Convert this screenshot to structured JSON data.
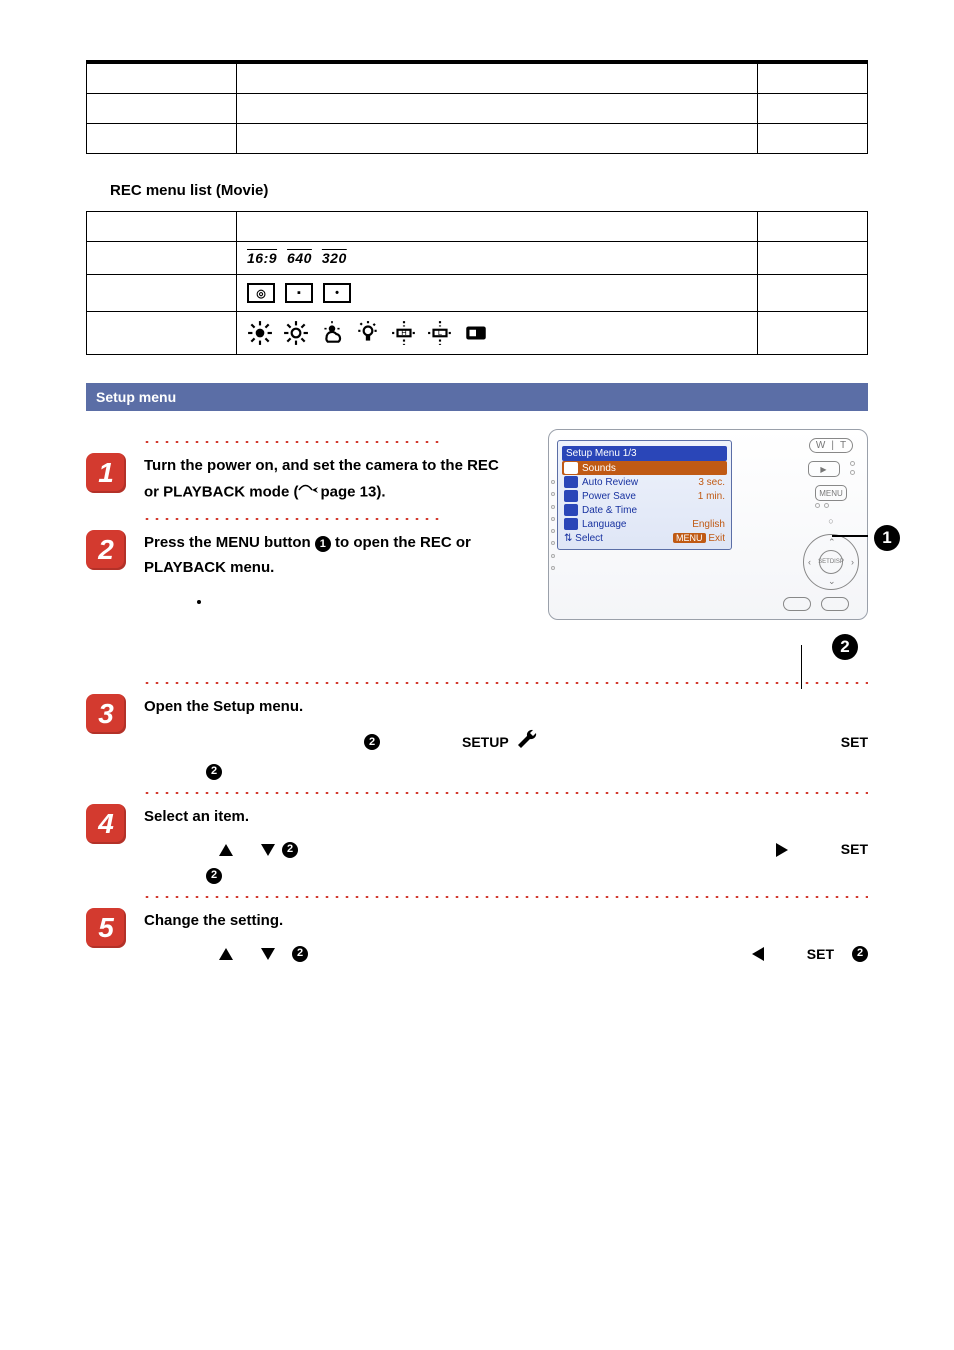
{
  "table1": {
    "rows": [
      {
        "c1": "",
        "c2": "",
        "c3": ""
      },
      {
        "c1": "",
        "c2": "",
        "c3": ""
      },
      {
        "c1": "",
        "c2": "",
        "c3": ""
      }
    ]
  },
  "rec_heading": "REC menu list (Movie)",
  "table2": {
    "header": [
      "",
      "",
      ""
    ],
    "rows": {
      "movieSize": {
        "c1": "",
        "r1": "16:9",
        "r2": "640",
        "r3": "320",
        "c3": ""
      },
      "metering": {
        "c1": "",
        "c3": ""
      },
      "wb": {
        "c1": "",
        "c3": ""
      }
    }
  },
  "section_bar": "Setup menu",
  "steps": {
    "s1": {
      "num": "1",
      "title_a": "Turn the power on, and set the camera to the REC or PLAYBACK mode (",
      "title_b": "page 13)."
    },
    "s2": {
      "num": "2",
      "title_a": "Press the MENU button  ",
      "title_b": "  to open the REC or PLAYBACK menu.",
      "sub_a": ""
    },
    "s3": {
      "num": "3",
      "title": "Open the Setup menu.",
      "bullet_a": "",
      "setup_word": "SETUP",
      "bullet_b": "",
      "set_word": "SET"
    },
    "s4": {
      "num": "4",
      "title": "Select an item.",
      "bullet_a": "",
      "bullet_b": "",
      "set_word": "SET"
    },
    "s5": {
      "num": "5",
      "title": "Change the setting.",
      "bullet_a": "",
      "set_word": "SET"
    }
  },
  "callouts": {
    "c1": "1",
    "c2": "2"
  },
  "lcd": {
    "title": "Setup Menu 1/3",
    "rows": [
      {
        "label": "Sounds",
        "value": ""
      },
      {
        "label": "Auto Review",
        "value": "3 sec."
      },
      {
        "label": "Power Save",
        "value": "1 min."
      },
      {
        "label": "Date & Time",
        "value": ""
      },
      {
        "label": "Language",
        "value": "English"
      }
    ],
    "select": "Select",
    "exit_badge": "MENU",
    "exit": "Exit"
  },
  "ctrls": {
    "w": "W",
    "t": "T",
    "menu": "MENU",
    "set": "SET",
    "disp": "DISP"
  },
  "meter_icons": {
    "a": "◎",
    "b": "▪",
    "c": "•"
  }
}
